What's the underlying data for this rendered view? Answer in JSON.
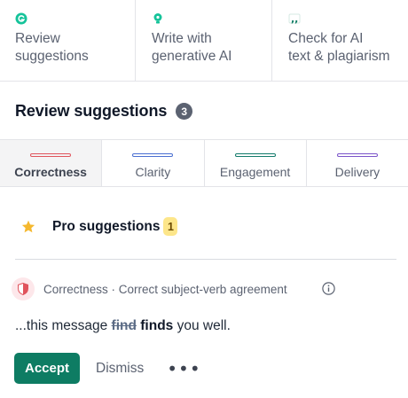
{
  "tools": [
    {
      "label": "Review\nsuggestions",
      "icon": "grammarly-g-icon",
      "color": "#15c39a"
    },
    {
      "label": "Write with\ngenerative AI",
      "icon": "bulb-icon",
      "color": "#15c39a"
    },
    {
      "label": "Check for AI\ntext & plagiarism",
      "icon": "quote-icon",
      "color": "#0e7c63"
    }
  ],
  "header": {
    "title": "Review suggestions",
    "count": "3"
  },
  "categories": [
    {
      "label": "Correctness",
      "color": "#e0535c",
      "active": true
    },
    {
      "label": "Clarity",
      "color": "#4a6fd1",
      "active": false
    },
    {
      "label": "Engagement",
      "color": "#127a6a",
      "active": false
    },
    {
      "label": "Delivery",
      "color": "#7b54c9",
      "active": false
    }
  ],
  "pro": {
    "label": "Pro suggestions",
    "count": "1",
    "star_color": "#f5b82e"
  },
  "suggestion": {
    "meta": "Correctness · Correct subject-verb agreement",
    "prefix": "...this message ",
    "removed": "find",
    "inserted": "finds",
    "suffix": " you well."
  },
  "actions": {
    "accept": "Accept",
    "dismiss": "Dismiss",
    "more": "•••"
  }
}
